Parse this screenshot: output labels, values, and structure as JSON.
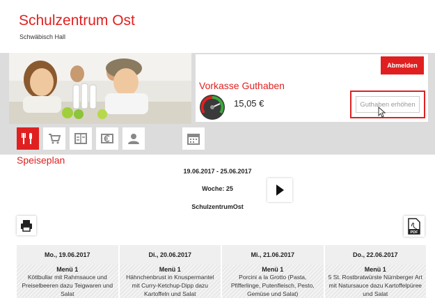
{
  "header": {
    "title": "Schulzentrum Ost",
    "subtitle": "Schwäbisch Hall"
  },
  "account": {
    "logout_label": "Abmelden",
    "credit_title": "Vorkasse Guthaben",
    "credit_amount": "15,05 €",
    "topup_label": "Guthaben erhöhen"
  },
  "nav": {
    "items": [
      {
        "icon": "cutlery-icon",
        "active": true
      },
      {
        "icon": "cart-icon",
        "active": false
      },
      {
        "icon": "menu-card-icon",
        "active": false
      },
      {
        "icon": "euro-icon",
        "active": false
      },
      {
        "icon": "user-icon",
        "active": false
      },
      {
        "icon": "calendar-icon",
        "active": false
      }
    ]
  },
  "plan": {
    "title": "Speiseplan",
    "range": "19.06.2017 - 25.06.2017",
    "week": "Woche: 25",
    "school": "SchulzentrumOst"
  },
  "days": [
    {
      "date": "Mo., 19.06.2017",
      "menu": "Menü 1",
      "desc": "Köttbullar mit Rahmsauce und Preiselbeeren dazu Teigwaren und Salat"
    },
    {
      "date": "Di., 20.06.2017",
      "menu": "Menü 1",
      "desc": "Hähnchenbrust in Knuspermantel mit Curry-Ketchup-Dipp dazu Kartoffeln und Salat"
    },
    {
      "date": "Mi., 21.06.2017",
      "menu": "Menü 1",
      "desc": "Porcini a la Grotto (Pasta, Pfifferlinge, Putenfleisch, Pesto, Gemüse und Salat)"
    },
    {
      "date": "Do., 22.06.2017",
      "menu": "Menü 1",
      "desc": "5 St. Rostbratwürste Nürnberger Art mit Natursauce dazu Kartoffelpüree und Salat"
    }
  ],
  "colors": {
    "accent": "#e02020",
    "banner_bg": "#dcdcdc"
  }
}
